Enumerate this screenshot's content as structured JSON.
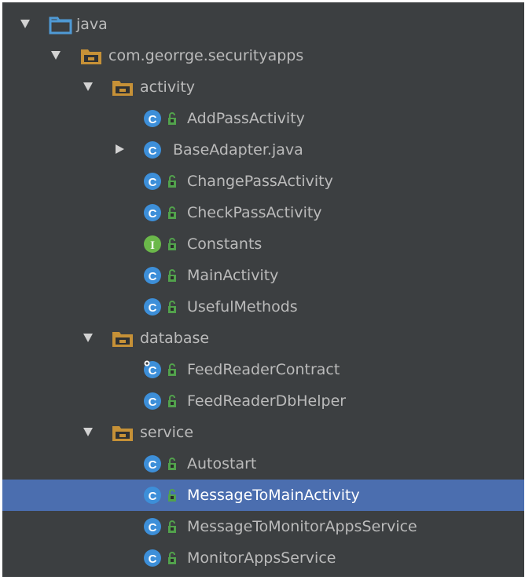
{
  "tree": {
    "root": {
      "label": "java",
      "icon": "source-root-folder-icon",
      "expanded": true
    },
    "package": {
      "label": "com.georrge.securityapps",
      "icon": "package-folder-icon",
      "expanded": true
    },
    "activity": {
      "label": "activity",
      "icon": "package-folder-icon",
      "expanded": true,
      "items": [
        {
          "label": "AddPassActivity",
          "kind": "class",
          "public": true
        },
        {
          "label": "BaseAdapter.java",
          "kind": "class",
          "public": false,
          "expandable": true
        },
        {
          "label": "ChangePassActivity",
          "kind": "class",
          "public": true
        },
        {
          "label": "CheckPassActivity",
          "kind": "class",
          "public": true
        },
        {
          "label": "Constants",
          "kind": "interface",
          "public": true
        },
        {
          "label": "MainActivity",
          "kind": "class",
          "public": true
        },
        {
          "label": "UsefulMethods",
          "kind": "class",
          "public": true
        }
      ]
    },
    "database": {
      "label": "database",
      "icon": "package-folder-icon",
      "expanded": true,
      "items": [
        {
          "label": "FeedReaderContract",
          "kind": "class-static",
          "public": true
        },
        {
          "label": "FeedReaderDbHelper",
          "kind": "class",
          "public": true
        }
      ]
    },
    "service": {
      "label": "service",
      "icon": "package-folder-icon",
      "expanded": true,
      "items": [
        {
          "label": "Autostart",
          "kind": "class",
          "public": true
        },
        {
          "label": "MessageToMainActivity",
          "kind": "class",
          "public": true,
          "selected": true
        },
        {
          "label": "MessageToMonitorAppsService",
          "kind": "class",
          "public": true
        },
        {
          "label": "MonitorAppsService",
          "kind": "class",
          "public": true
        }
      ]
    }
  },
  "colors": {
    "background": "#3c3f41",
    "selection": "#4b6eaf",
    "text": "#bbbbbb",
    "selected_text": "#ffffff",
    "class_icon": "#3d8fd9",
    "interface_icon": "#6bb84a",
    "folder": "#c69137",
    "source_root_folder": "#4f9ad5",
    "public_lock": "#52a24c",
    "arrow": "#d2d2d2"
  }
}
